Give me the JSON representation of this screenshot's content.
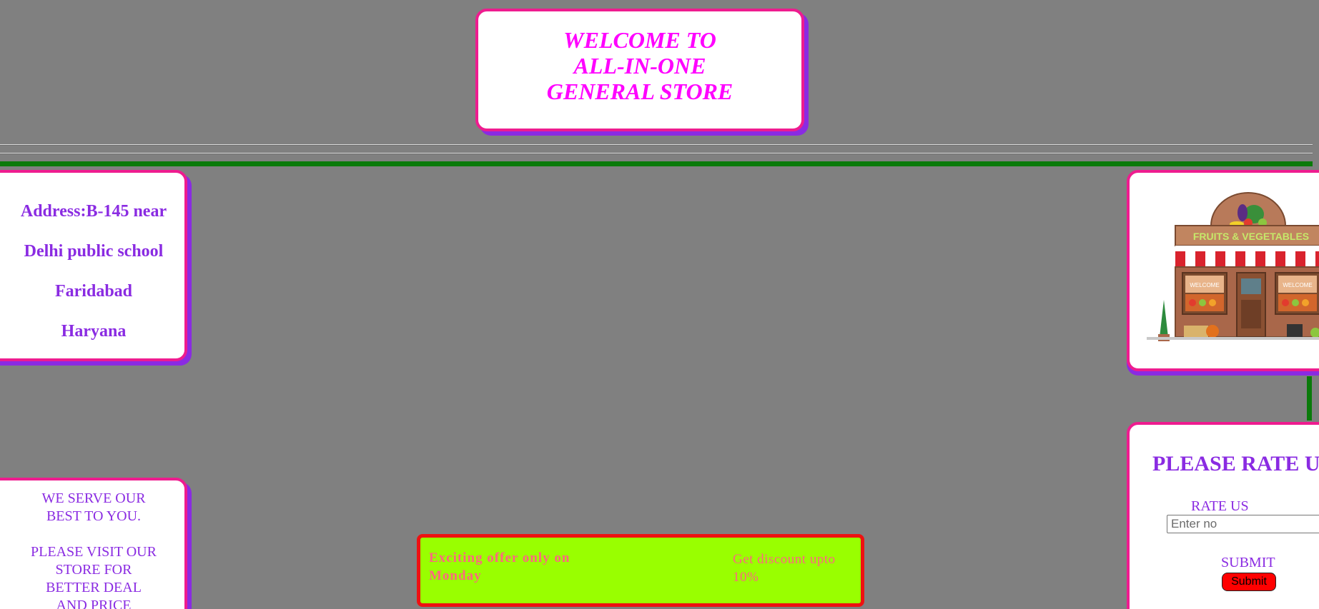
{
  "header": {
    "title_lines": [
      "WELCOME TO",
      "ALL-IN-ONE",
      "GENERAL STORE"
    ]
  },
  "address": {
    "lines": [
      "Address:B-145 near",
      "Delhi public school",
      "Faridabad",
      "Haryana"
    ]
  },
  "serve": {
    "para1": [
      "WE SERVE OUR",
      "BEST TO YOU."
    ],
    "para2": [
      "PLEASE VISIT OUR",
      "STORE FOR",
      "BETTER DEAL",
      "AND PRICE"
    ]
  },
  "store_image": {
    "sign_text": "FRUITS & VEGETABLES",
    "window_left": "WELCOME",
    "window_right": "WELCOME"
  },
  "rating": {
    "heading": "PLEASE RATE US",
    "rate_label": "RATE US",
    "input_placeholder": "Enter no",
    "submit_label": "SUBMIT",
    "submit_button": "Submit"
  },
  "offer": {
    "left_text": "Exciting offer only on Monday",
    "right_text": "Get discount upto 10%"
  },
  "colors": {
    "page_background": "#808080",
    "card_border": "#ee1c8f",
    "card_shadow": "#8a2be2",
    "title_text": "#ff00ff",
    "body_text": "#8a2be2",
    "divider_green": "#0a7a0a",
    "offer_background": "#99ff00",
    "offer_border": "#ee1111",
    "offer_text": "#ff6680",
    "submit_button": "#ff0000"
  }
}
